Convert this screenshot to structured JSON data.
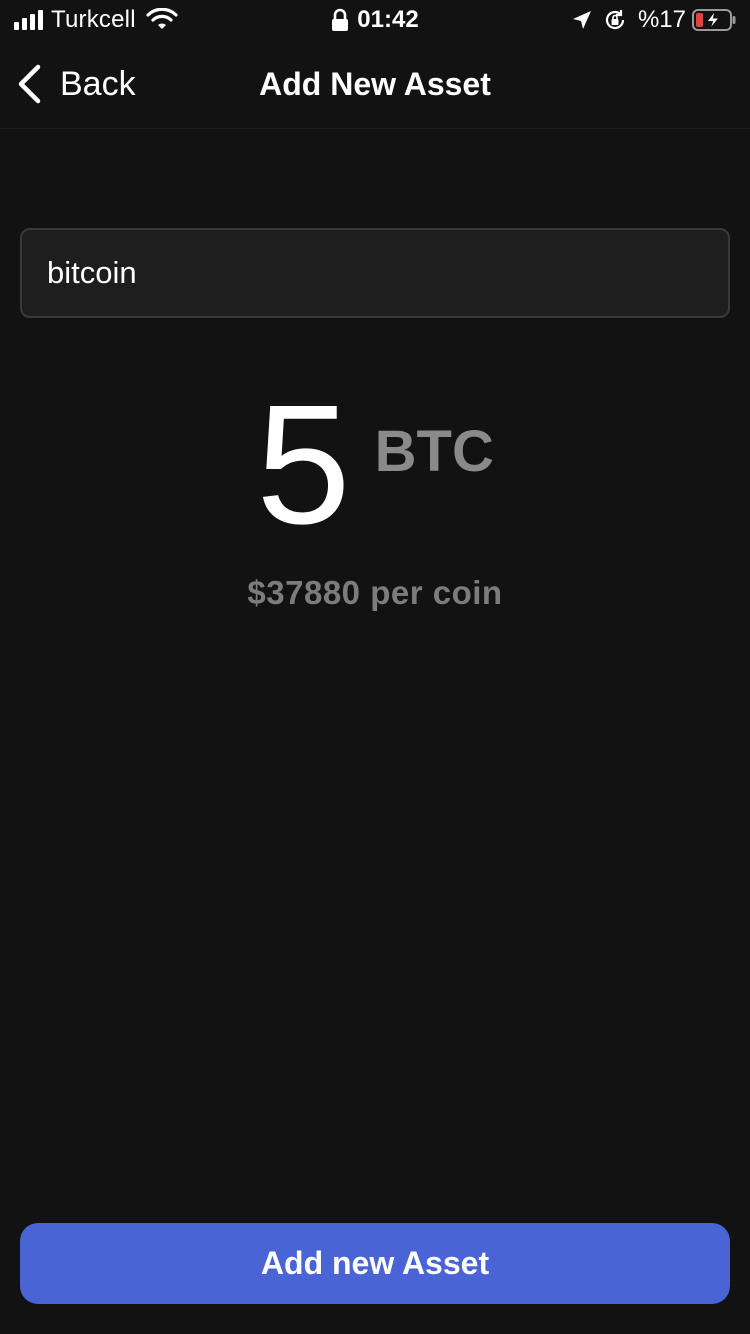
{
  "status_bar": {
    "carrier": "Turkcell",
    "time": "01:42",
    "battery_percent": "%17",
    "signal_bars": 4,
    "icons": [
      "signal-icon",
      "wifi-icon",
      "lock-icon",
      "location-icon",
      "rotation-lock-icon",
      "battery-charging-icon"
    ]
  },
  "nav": {
    "back_label": "Back",
    "title": "Add New Asset"
  },
  "search": {
    "value": "bitcoin"
  },
  "amount": {
    "value": "5",
    "unit": "BTC",
    "price_per_coin": "$37880 per coin"
  },
  "actions": {
    "add_label": "Add new Asset"
  },
  "colors": {
    "background": "#121212",
    "primary_button": "#4a64d6",
    "muted_text": "#7c7c7c",
    "battery_low": "#e0443e"
  }
}
